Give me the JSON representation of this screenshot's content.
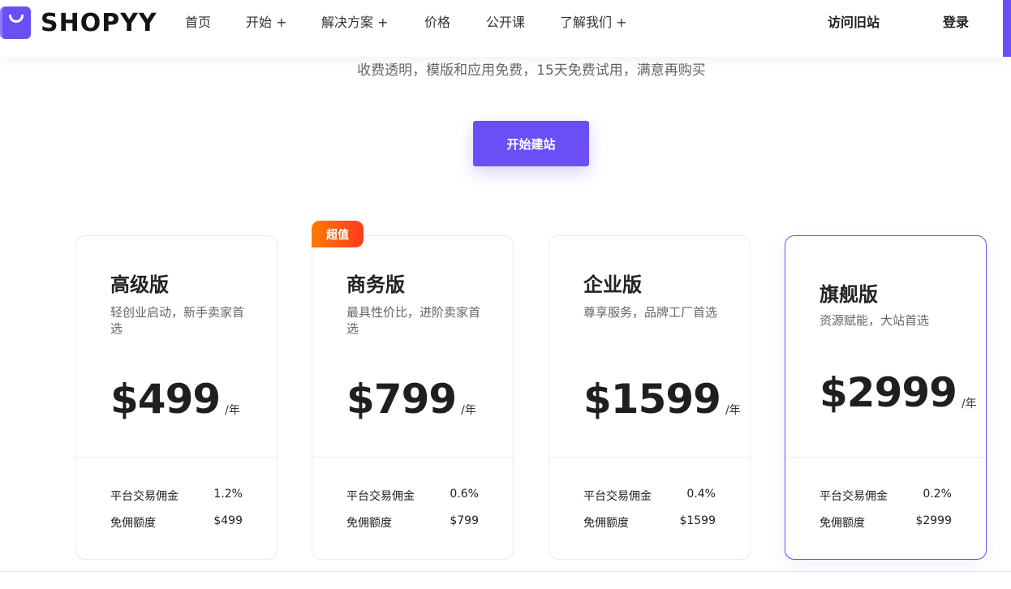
{
  "nav": {
    "logo_text": "SHOPYY",
    "items": [
      "首页",
      "开始 +",
      "解决方案 +",
      "价格",
      "公开课",
      "了解我们 +"
    ],
    "visit_old_site": "访问旧站",
    "login": "登录"
  },
  "hero": {
    "subtitle": "收费透明，模版和应用免费，15天免费试用，满意再购买",
    "cta_label": "开始建站"
  },
  "badge": "超值",
  "plans": [
    {
      "name": "高级版",
      "desc": "轻创业启动，新手卖家首选",
      "price": "$499",
      "unit": "/年",
      "commission_label": "平台交易佣金",
      "commission": "1.2%",
      "free_label": "免佣额度",
      "free": "$499"
    },
    {
      "name": "商务版",
      "desc": "最具性价比，进阶卖家首选",
      "price": "$799",
      "unit": "/年",
      "commission_label": "平台交易佣金",
      "commission": "0.6%",
      "free_label": "免佣额度",
      "free": "$799"
    },
    {
      "name": "企业版",
      "desc": "尊享服务，品牌工厂首选",
      "price": "$1599",
      "unit": "/年",
      "commission_label": "平台交易佣金",
      "commission": "0.4%",
      "free_label": "免佣额度",
      "free": "$1599"
    },
    {
      "name": "旗舰版",
      "desc": "资源赋能，大站首选",
      "price": "$2999",
      "unit": "/年",
      "commission_label": "平台交易佣金",
      "commission": "0.2%",
      "free_label": "免佣额度",
      "free": "$2999"
    }
  ],
  "colors": {
    "accent": "#6b4ef6",
    "badge_start": "#ff7a00",
    "badge_end": "#ff3b1f"
  },
  "icons": {
    "logo": "shopping-bag-icon"
  }
}
